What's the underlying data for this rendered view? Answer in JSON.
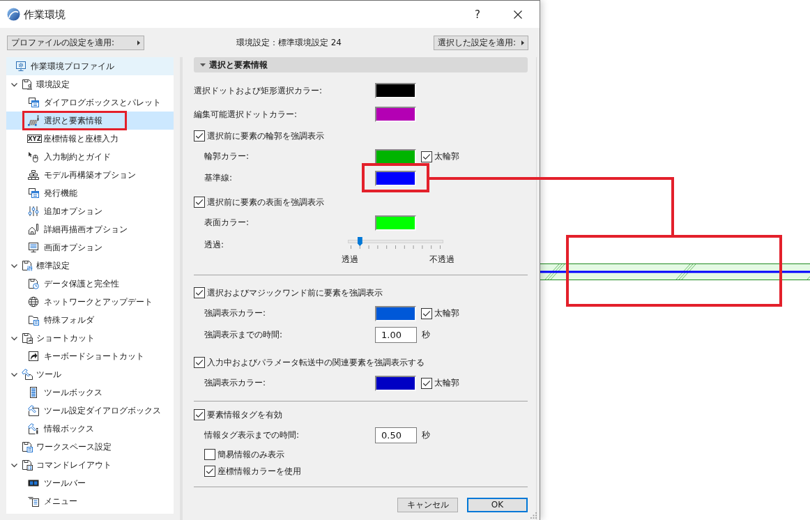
{
  "window": {
    "title": "作業環境",
    "help_button": "?"
  },
  "toolbar": {
    "profile_button": "プロファイルの設定を適用:",
    "current_profile": "環境設定：標準環境設定 24",
    "apply_button": "選択した設定を適用:"
  },
  "tree": {
    "items": [
      {
        "label": "作業環境プロファイル",
        "kind": "profile",
        "selected": false,
        "hovered": true,
        "annotated": false
      },
      {
        "label": "環境設定",
        "kind": "section",
        "expanded": true,
        "selected": false,
        "hovered": false,
        "annotated": false,
        "children": [
          {
            "label": "ダイアログボックスとパレット",
            "selected": false,
            "hovered": false,
            "annotated": false
          },
          {
            "label": "選択と要素情報",
            "selected": true,
            "hovered": false,
            "annotated": true
          },
          {
            "label": "座標情報と座標入力",
            "icon_text": "XYZ",
            "selected": false,
            "hovered": false,
            "annotated": false
          },
          {
            "label": "入力制約とガイド",
            "selected": false,
            "hovered": false,
            "annotated": false
          },
          {
            "label": "モデル再構築オプション",
            "selected": false,
            "hovered": false,
            "annotated": false
          },
          {
            "label": "発行機能",
            "selected": false,
            "hovered": false,
            "annotated": false
          },
          {
            "label": "追加オプション",
            "selected": false,
            "hovered": false,
            "annotated": false
          },
          {
            "label": "詳細再描画オプション",
            "selected": false,
            "hovered": false,
            "annotated": false
          },
          {
            "label": "画面オプション",
            "selected": false,
            "hovered": false,
            "annotated": false
          }
        ]
      },
      {
        "label": "標準設定",
        "kind": "section",
        "expanded": true,
        "selected": false,
        "hovered": false,
        "annotated": false,
        "children": [
          {
            "label": "データ保護と完全性",
            "selected": false,
            "hovered": false,
            "annotated": false
          },
          {
            "label": "ネットワークとアップデート",
            "selected": false,
            "hovered": false,
            "annotated": false
          },
          {
            "label": "特殊フォルダ",
            "selected": false,
            "hovered": false,
            "annotated": false
          }
        ]
      },
      {
        "label": "ショートカット",
        "kind": "section",
        "expanded": true,
        "selected": false,
        "hovered": false,
        "annotated": false,
        "children": [
          {
            "label": "キーボードショートカット",
            "selected": false,
            "hovered": false,
            "annotated": false
          }
        ]
      },
      {
        "label": "ツール",
        "kind": "section",
        "expanded": true,
        "selected": false,
        "hovered": false,
        "annotated": false,
        "children": [
          {
            "label": "ツールボックス",
            "selected": false,
            "hovered": false,
            "annotated": false
          },
          {
            "label": "ツール設定ダイアログボックス",
            "selected": false,
            "hovered": false,
            "annotated": false
          },
          {
            "label": "情報ボックス",
            "selected": false,
            "hovered": false,
            "annotated": false
          }
        ]
      },
      {
        "label": "ワークスペース設定",
        "kind": "section",
        "selected": false,
        "hovered": false,
        "annotated": false
      },
      {
        "label": "コマンドレイアウト",
        "kind": "section",
        "expanded": true,
        "selected": false,
        "hovered": false,
        "annotated": false,
        "children": [
          {
            "label": "ツールバー",
            "selected": false,
            "hovered": false,
            "annotated": false
          },
          {
            "label": "メニュー",
            "selected": false,
            "hovered": false,
            "annotated": false
          }
        ]
      }
    ]
  },
  "panel": {
    "title": "選択と要素情報",
    "expanded": true,
    "groups": [
      {
        "rows": [
          {
            "kind": "color",
            "label": "選択ドットおよび矩形選択カラー:",
            "color": "#000000",
            "annotated": false
          },
          {
            "kind": "color",
            "label": "編集可能選択ドットカラー:",
            "color": "#b400b4",
            "annotated": false
          },
          {
            "kind": "checkbox",
            "label": "選択前に要素の輪郭を強調表示",
            "checked": true,
            "children": [
              {
                "kind": "color",
                "label": "輪郭カラー:",
                "color": "#00b400",
                "annotated": false,
                "thick_outline": {
                  "label": "太輪郭",
                  "checked": true
                }
              },
              {
                "kind": "color",
                "label": "基準線:",
                "color": "#0000ff",
                "annotated": true
              }
            ]
          },
          {
            "kind": "checkbox",
            "label": "選択前に要素の表面を強調表示",
            "checked": true,
            "children": [
              {
                "kind": "color",
                "label": "表面カラー:",
                "color": "#00ff00",
                "annotated": false
              },
              {
                "kind": "slider",
                "label": "透過:",
                "level": 0.1,
                "min_label": "透過",
                "max_label": "不透過"
              }
            ]
          }
        ]
      },
      {
        "rows": [
          {
            "kind": "checkbox",
            "label": "選択およびマジックワンド前に要素を強調表示",
            "checked": true,
            "children": [
              {
                "kind": "color",
                "label": "強調表示カラー:",
                "color": "#0058d8",
                "annotated": false,
                "thick_outline": {
                  "label": "太輪郭",
                  "checked": true
                }
              },
              {
                "kind": "number",
                "label": "強調表示までの時間:",
                "value": "1.00",
                "unit": "秒"
              }
            ]
          },
          {
            "kind": "checkbox",
            "label": "入力中およびパラメータ転送中の関連要素を強調表示する",
            "checked": true,
            "children": [
              {
                "kind": "color",
                "label": "強調表示カラー:",
                "color": "#0000c4",
                "annotated": false,
                "thick_outline": {
                  "label": "太輪郭",
                  "checked": true
                }
              }
            ]
          }
        ]
      },
      {
        "rows": [
          {
            "kind": "checkbox",
            "label": "要素情報タグを有効",
            "checked": true,
            "children": [
              {
                "kind": "number",
                "label": "情報タグ表示までの時間:",
                "value": "0.50",
                "unit": "秒"
              },
              {
                "kind": "checkbox",
                "label": "簡易情報のみ表示",
                "checked": false
              },
              {
                "kind": "checkbox",
                "label": "座標情報カラーを使用",
                "checked": true
              }
            ]
          }
        ]
      }
    ]
  },
  "buttons": [
    {
      "label": "キャンセル",
      "default": false
    },
    {
      "label": "OK",
      "default": true
    }
  ]
}
